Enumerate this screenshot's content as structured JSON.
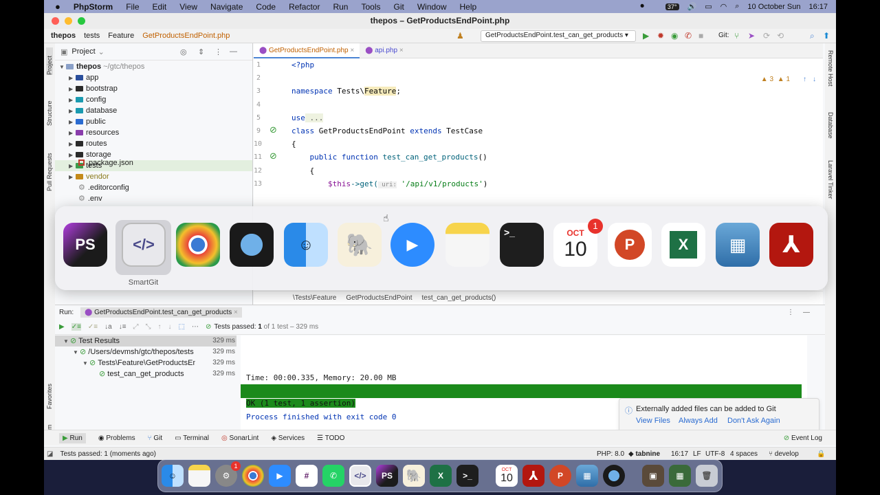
{
  "menubar": {
    "app": "PhpStorm",
    "items": [
      "File",
      "Edit",
      "View",
      "Navigate",
      "Code",
      "Refactor",
      "Run",
      "Tools",
      "Git",
      "Window",
      "Help"
    ],
    "temp": "37°",
    "date": "10 October Sun",
    "time": "16:17"
  },
  "window": {
    "title": "thepos – GetProductsEndPoint.php"
  },
  "navbar": {
    "crumb1": "thepos",
    "crumb2": "tests",
    "crumb3": "Feature",
    "crumb4": "GetProductsEndPoint.php",
    "run_config": "GetProductsEndPoint.test_can_get_products",
    "git": "Git:"
  },
  "project": {
    "title": "Project",
    "root": "thepos",
    "root_path": "~/gtc/thepos",
    "items": [
      {
        "label": "app",
        "color": "#2a4e9c",
        "arrow": true
      },
      {
        "label": "bootstrap",
        "color": "#2b2b2b",
        "arrow": true
      },
      {
        "label": "config",
        "color": "#1a9ab0",
        "arrow": true
      },
      {
        "label": "database",
        "color": "#1a9ab0",
        "arrow": true
      },
      {
        "label": "public",
        "color": "#2a6bd1",
        "arrow": true
      },
      {
        "label": "resources",
        "color": "#8a3dac",
        "arrow": true
      },
      {
        "label": "routes",
        "color": "#2b2b2b",
        "arrow": true
      },
      {
        "label": "storage",
        "color": "#2b2b2b",
        "arrow": true
      },
      {
        "label": "tests",
        "color": "#3b9c4a",
        "arrow": true
      },
      {
        "label": "vendor",
        "color": "#c48a1a",
        "arrow": true
      },
      {
        "label": ".editorconfig",
        "color": "",
        "arrow": false
      },
      {
        "label": ".env",
        "color": "",
        "arrow": false
      }
    ],
    "package": "package.json"
  },
  "editor": {
    "tabs": [
      "GetProductsEndPoint.php",
      "api.php"
    ],
    "lines": [
      "1",
      "2",
      "3",
      "4",
      "5",
      "9",
      "10",
      "11",
      "12",
      "13"
    ],
    "warn": "3",
    "info": "1",
    "code": {
      "php": "<?php",
      "ns_kw": "namespace",
      "ns_rest": " Tests\\",
      "ns_feat": "Feature",
      "semi": ";",
      "use_kw": "use",
      "dots": " ...",
      "class_kw": "class",
      "class_name": " GetProductsEndPoint ",
      "extends": "extends",
      "parent": " TestCase",
      "brace_open": "{",
      "public": "    public function ",
      "method": "test_can_get_products",
      "parens": "()",
      "inner_brace": "    {",
      "this": "        $this",
      "get": "->get(",
      "uri": " uri:",
      "url": " '/api/v1/products'",
      "close": ")"
    },
    "crumbs": [
      "\\Tests\\Feature",
      "GetProductsEndPoint",
      "test_can_get_products()"
    ]
  },
  "switcher": {
    "selected": "SmartGit"
  },
  "run": {
    "label": "Run:",
    "config": "GetProductsEndPoint.test_can_get_products",
    "passed": "Tests passed:",
    "count": "1",
    "of": "of 1 test – 329 ms",
    "results": [
      {
        "label": "Test Results",
        "ms": "329 ms"
      },
      {
        "label": "/Users/devmsh/gtc/thepos/tests",
        "ms": "329 ms"
      },
      {
        "label": "Tests\\Feature\\GetProductsEndPoint",
        "ms": "329 ms"
      },
      {
        "label": "test_can_get_products",
        "ms": "329 ms"
      }
    ],
    "console": {
      "time": "Time: 00:00.335, Memory: 20.00 MB",
      "ok": "OK (1 test, 1 assertion)",
      "finished": "Process finished with exit code 0"
    }
  },
  "notification": {
    "text": "Externally added files can be added to Git",
    "a1": "View Files",
    "a2": "Always Add",
    "a3": "Don't Ask Again"
  },
  "bottomtabs": [
    "Run",
    "Problems",
    "Git",
    "Terminal",
    "SonarLint",
    "Services",
    "TODO"
  ],
  "eventlog": "Event Log",
  "status": {
    "left": "Tests passed: 1 (moments ago)",
    "php": "PHP: 8.0",
    "tabnine": "tabnine",
    "pos": "16:17",
    "lf": "LF",
    "enc": "UTF-8",
    "indent": "4 spaces",
    "branch": "develop"
  },
  "side": {
    "left": [
      "Project",
      "Structure",
      "Pull Requests"
    ],
    "left2": [
      "Favorites",
      "npm"
    ],
    "right": [
      "Remote Host",
      "Database",
      "Laravel Tinker"
    ]
  },
  "calendar": {
    "month": "OCT",
    "day": "10",
    "badge": "1"
  },
  "dock": {
    "cal_month": "OCT",
    "cal_day": "10",
    "badge": "1"
  }
}
